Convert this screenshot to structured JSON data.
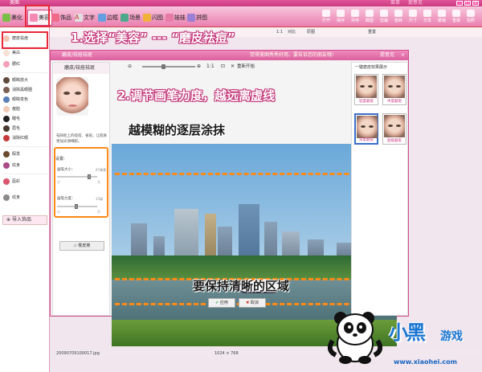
{
  "titlebar": {
    "app_title": "美图",
    "menu": "菜单",
    "help": "提意见"
  },
  "toolbar": {
    "tabs": [
      {
        "label": "美化"
      },
      {
        "label": "美容"
      },
      {
        "label": "饰品"
      },
      {
        "label": "文字"
      },
      {
        "label": "边框"
      },
      {
        "label": "场景"
      },
      {
        "label": "闪图"
      },
      {
        "label": "娃娃"
      },
      {
        "label": "拼图"
      }
    ],
    "right_tools": [
      "打开",
      "保存",
      "另存",
      "截图",
      "剪裁",
      "旋转",
      "尺寸",
      "分享",
      "撤销",
      "重做",
      "拍照"
    ]
  },
  "sidebar": {
    "items": [
      "磨皮祛痘",
      "美白",
      "腮红",
      "眼睛放大",
      "消除黑眼圈",
      "眼睛变色",
      "瘦脸",
      "睫毛",
      "眉毛",
      "消除红眼",
      "假发",
      "纹身",
      "唇彩",
      "纹身"
    ],
    "import_label": "导入饰品"
  },
  "canvas_bar": {
    "zoom": "1:1",
    "compare": "对比",
    "original": "原图",
    "reset": "重置"
  },
  "dialog": {
    "title": "磨皮/祛痘祛斑",
    "notice": "觉得美图秀秀好用，要告诉您的朋友哦!",
    "feedback": "提意见",
    "close": "×",
    "tool_head": "磨皮/祛痘祛斑",
    "tool_desc": "祛除脸上的痘痘、雀斑，让肌肤更加光滑细腻。",
    "settings_title": "设置:",
    "brush_size_label": "画笔大小：",
    "brush_size_value": "67像素",
    "brush_strength_label": "画笔力度：",
    "brush_strength_value": "15级",
    "slider_min": "小",
    "slider_max": "大",
    "eraser": "橡皮擦",
    "zoom_ratio": "1:1",
    "restart": "重新开始",
    "effect_title": "一键磨皮效果展示",
    "effects": [
      "轻度磨皮",
      "中度磨皮",
      "深度磨皮",
      "超级磨皮"
    ],
    "apply": "应用",
    "cancel": "取消"
  },
  "annotations": {
    "step1": "1.选择“美容” --- “磨皮祛痘”",
    "step2": "2.调节画笔力度，越远离虚线",
    "step2b": "越模糊的逐层涂抹",
    "keep_clear": "要保持清晰的区域"
  },
  "status": {
    "filename": "20090709100017.jpg",
    "size": "1024 × 768"
  },
  "watermark": {
    "name": "小黑",
    "game": "游戏",
    "url": "www.xiaohei.com"
  }
}
